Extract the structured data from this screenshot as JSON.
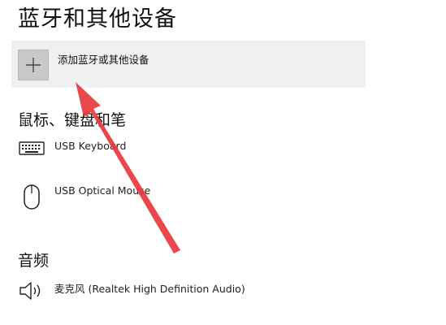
{
  "page": {
    "title": "蓝牙和其他设备"
  },
  "add_device": {
    "label": "添加蓝牙或其他设备",
    "icon": "plus-icon"
  },
  "sections": {
    "input": {
      "title": "鼠标、键盘和笔",
      "devices": [
        {
          "name": "USB Keyboard",
          "icon": "keyboard-icon"
        },
        {
          "name": "USB Optical Mouse",
          "icon": "mouse-icon"
        }
      ]
    },
    "audio": {
      "title": "音频",
      "devices": [
        {
          "name": "麦克风 (Realtek High Definition Audio)",
          "icon": "speaker-icon"
        }
      ]
    }
  },
  "annotation": {
    "arrow_color": "#e8383d"
  }
}
